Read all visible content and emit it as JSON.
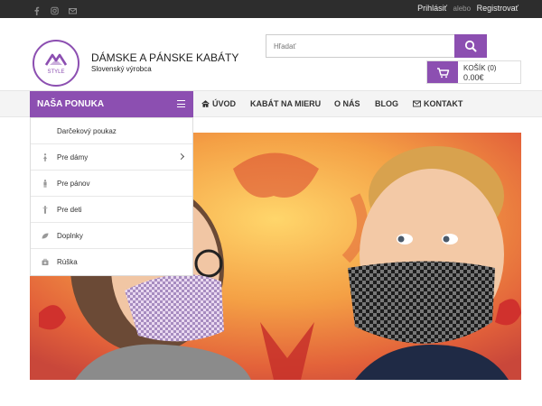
{
  "topbar": {
    "social_icons": [
      "facebook-icon",
      "instagram-icon",
      "email-icon"
    ],
    "login": "Prihlásiť",
    "or": "alebo",
    "register": "Registrovať"
  },
  "header": {
    "logo_text": "STYLE",
    "title": "DÁMSKE A PÁNSKE KABÁTY",
    "subtitle": "Slovenský výrobca",
    "search_placeholder": "Hľadať",
    "cart_label": "KOŠÍK (0)",
    "cart_price": "0.00€"
  },
  "nav": {
    "offer": "NAŠA PONUKA",
    "links": [
      "ÚVOD",
      "KABÁT NA MIERU",
      "O NÁS",
      "BLOG",
      "KONTAKT"
    ]
  },
  "menu": {
    "items": [
      "Darčekový poukaz",
      "Pre dámy",
      "Pre pánov",
      "Pre deti",
      "Doplnky",
      "Rúška"
    ]
  },
  "colors": {
    "accent": "#8c4fb1",
    "topbar": "#2d2d2d"
  }
}
